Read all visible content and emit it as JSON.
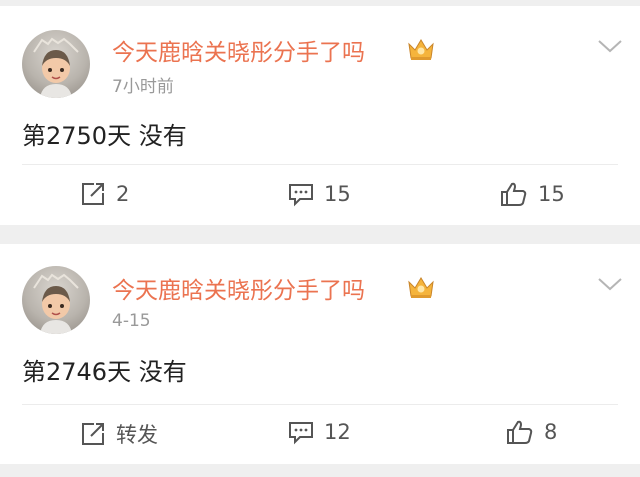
{
  "posts": [
    {
      "username": "今天鹿晗关晓彤分手了吗",
      "timestamp": "7小时前",
      "content": "第2750天 没有",
      "actions": {
        "repost": "2",
        "comment": "15",
        "like": "15"
      },
      "avatar_icon": "cartoon-girl-avatar",
      "badge_icon": "crown-badge-icon"
    },
    {
      "username": "今天鹿晗关晓彤分手了吗",
      "timestamp": "4-15",
      "content": "第2746天 没有",
      "actions": {
        "repost": "转发",
        "comment": "12",
        "like": "8"
      },
      "avatar_icon": "cartoon-girl-avatar",
      "badge_icon": "crown-badge-icon"
    }
  ],
  "colors": {
    "username": "#eb7350",
    "badge": "#f5b43c",
    "background": "#efefef"
  }
}
